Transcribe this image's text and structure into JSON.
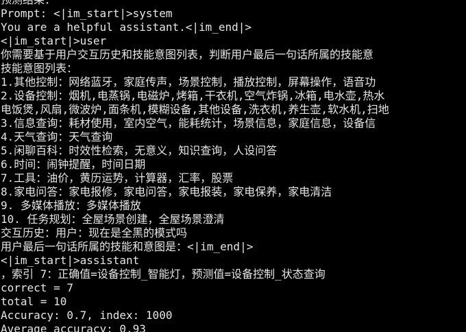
{
  "terminal": {
    "lines": [
      "预测结果：",
      "Prompt: <|im_start|>system",
      "You are a helpful assistant.<|im_end|>",
      "<|im_start|>user",
      "你需要基于用户交互历史和技能意图列表，判断用户最后一句话所属的技能意",
      "技能意图列表：",
      "1.其他控制：网络蓝牙，家庭传声，场景控制，播放控制，屏幕操作，语音功",
      "2.设备控制：烟机,电蒸锅,电磁炉,烤箱,干衣机,空气炸锅,冰箱,电水壶,热水",
      "电饭煲,风扇,微波炉,面条机,模糊设备,其他设备,洗衣机,养生壶,软水机,扫地",
      "3.信息查询：耗材使用，室内空气，能耗统计，场景信息，家庭信息，设备信",
      "4.天气查询：天气查询",
      "5.闲聊百科：时效性检索，无意义，知识查询，人设问答",
      "6.时间：闹钟提醒，时间日期",
      "7.工具：油价，黄历运势，计算器，汇率，股票",
      "8.家电问答：家电报修，家电问答，家电报装，家电保养，家电清洁",
      "9. 多媒体播放：多媒体播放",
      "10. 任务规划：全屋场景创建，全屋场景澄清",
      "交互历史：用户：现在是全黑的模式吗",
      "用户最后一句话所属的技能和意图是：<|im_end|>",
      "<|im_start|>assistant",
      "，索引 7：正确值=设备控制_智能灯，预测值=设备控制_状态查询",
      "correct = 7",
      "total = 10",
      "Accuracy: 0.7, index: 1000",
      "Average accuracy: 0.93"
    ]
  }
}
